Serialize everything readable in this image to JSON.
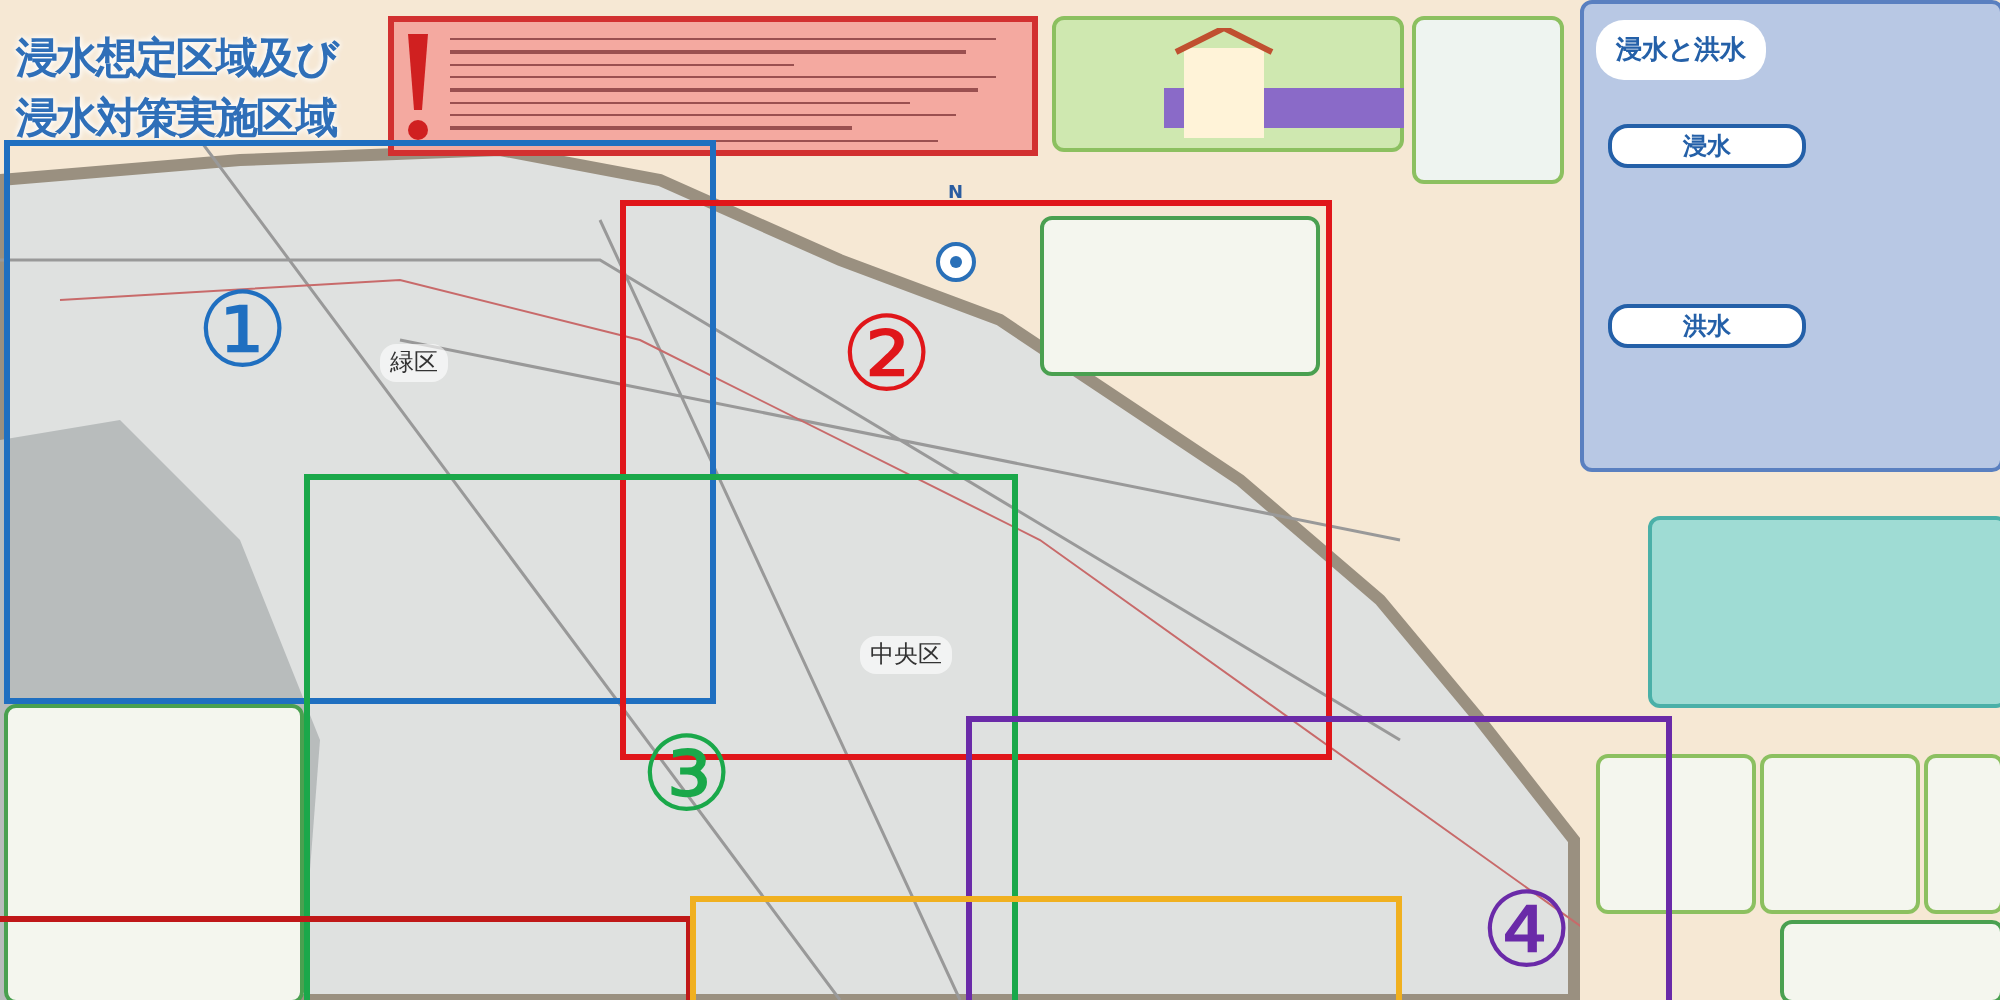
{
  "title": [
    "浸水想定区域及び",
    "浸水対策実施区域"
  ],
  "map": {
    "north": "N",
    "districts": [
      "緑区",
      "中央区"
    ]
  },
  "regions": [
    {
      "label": "①",
      "color": "#1f6fc0"
    },
    {
      "label": "②",
      "color": "#e0161a"
    },
    {
      "label": "③",
      "color": "#1aa84a"
    },
    {
      "label": "④",
      "color": "#6a2aa8"
    },
    {
      "color": "#c01818"
    },
    {
      "color": "#f0b020"
    }
  ],
  "side_panel": {
    "title": "浸水と洪水",
    "sections": [
      "浸水",
      "洪水"
    ]
  }
}
